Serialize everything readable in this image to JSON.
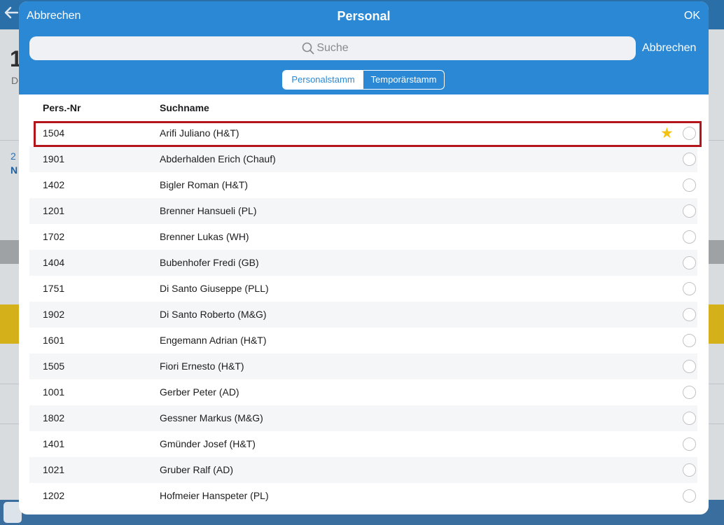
{
  "background": {
    "back_icon": "arrow-left-icon",
    "big_digit": "1",
    "sub_letter": "D",
    "small_digit": "2",
    "bold_letter": "N"
  },
  "modal": {
    "title": "Personal",
    "cancel_label": "Abbrechen",
    "ok_label": "OK",
    "search": {
      "icon": "search-icon",
      "placeholder": "Suche",
      "value": "",
      "cancel_label": "Abbrechen"
    },
    "segments": [
      {
        "label": "Personalstamm",
        "selected": true
      },
      {
        "label": "Temporärstamm",
        "selected": false
      }
    ],
    "columns": {
      "number": "Pers.-Nr",
      "name": "Suchname"
    },
    "rows": [
      {
        "number": "1504",
        "name": "Arifi Juliano (H&T)",
        "favorite": true,
        "highlighted": true
      },
      {
        "number": "1901",
        "name": "Abderhalden Erich (Chauf)"
      },
      {
        "number": "1402",
        "name": "Bigler Roman (H&T)"
      },
      {
        "number": "1201",
        "name": "Brenner Hansueli (PL)"
      },
      {
        "number": "1702",
        "name": "Brenner Lukas (WH)"
      },
      {
        "number": "1404",
        "name": "Bubenhofer Fredi (GB)"
      },
      {
        "number": "1751",
        "name": "Di Santo Giuseppe (PLL)"
      },
      {
        "number": "1902",
        "name": "Di Santo Roberto (M&G)"
      },
      {
        "number": "1601",
        "name": "Engemann Adrian (H&T)"
      },
      {
        "number": "1505",
        "name": "Fiori Ernesto (H&T)"
      },
      {
        "number": "1001",
        "name": "Gerber Peter (AD)"
      },
      {
        "number": "1802",
        "name": "Gessner Markus (M&G)"
      },
      {
        "number": "1401",
        "name": "Gmünder Josef (H&T)"
      },
      {
        "number": "1021",
        "name": "Gruber Ralf (AD)"
      },
      {
        "number": "1202",
        "name": "Hofmeier Hanspeter (PL)"
      }
    ],
    "row_icons": {
      "favorite": "star-icon",
      "select": "radio-button"
    }
  },
  "colors": {
    "accent": "#2a88d4",
    "highlight_frame": "#b3151b",
    "favorite_star": "#f4c20d",
    "alt_row": "#f5f6f8"
  }
}
